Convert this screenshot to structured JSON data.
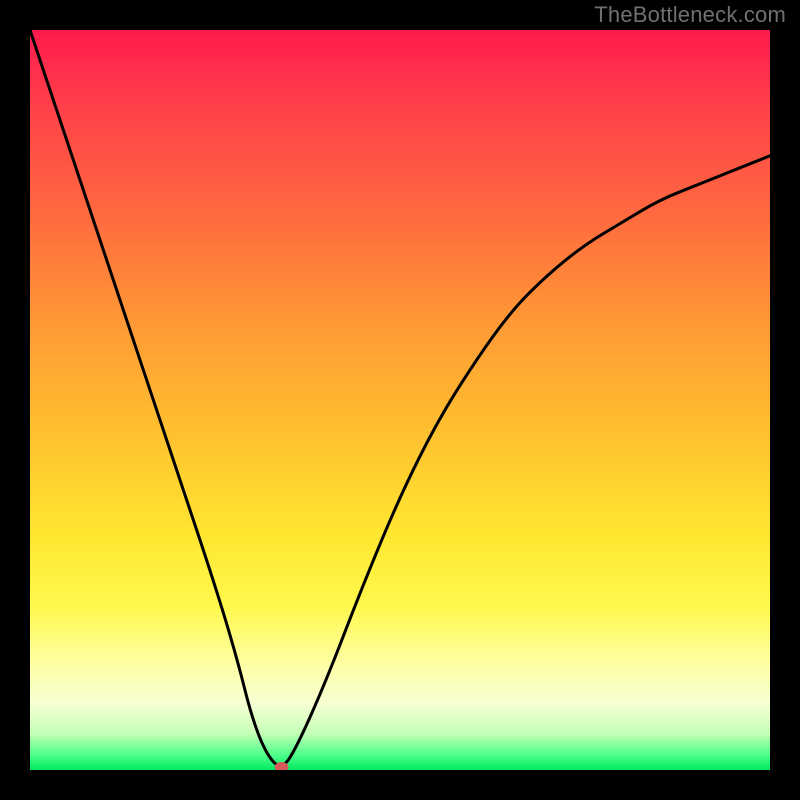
{
  "watermark": "TheBottleneck.com",
  "chart_data": {
    "type": "line",
    "title": "",
    "xlabel": "",
    "ylabel": "",
    "xlim": [
      0,
      100
    ],
    "ylim": [
      0,
      100
    ],
    "grid": false,
    "background": "red-yellow-green vertical gradient",
    "series": [
      {
        "name": "bottleneck-curve",
        "x": [
          0,
          5,
          10,
          15,
          20,
          25,
          28,
          30,
          32,
          34,
          36,
          40,
          45,
          50,
          55,
          60,
          65,
          70,
          75,
          80,
          85,
          90,
          95,
          100
        ],
        "values": [
          100,
          85,
          70,
          55,
          40,
          25,
          15,
          7,
          2,
          0,
          3,
          12,
          25,
          37,
          47,
          55,
          62,
          67,
          71,
          74,
          77,
          79,
          81,
          83
        ]
      }
    ],
    "marker": {
      "x": 34,
      "y": 0,
      "name": "optimal-point"
    },
    "gradient_stops": [
      {
        "pos": 0.0,
        "color": "#ff1a4d"
      },
      {
        "pos": 0.25,
        "color": "#ff6a3f"
      },
      {
        "pos": 0.55,
        "color": "#ffc22f"
      },
      {
        "pos": 0.78,
        "color": "#fff94e"
      },
      {
        "pos": 0.95,
        "color": "#c6ffb8"
      },
      {
        "pos": 1.0,
        "color": "#00e860"
      }
    ]
  }
}
